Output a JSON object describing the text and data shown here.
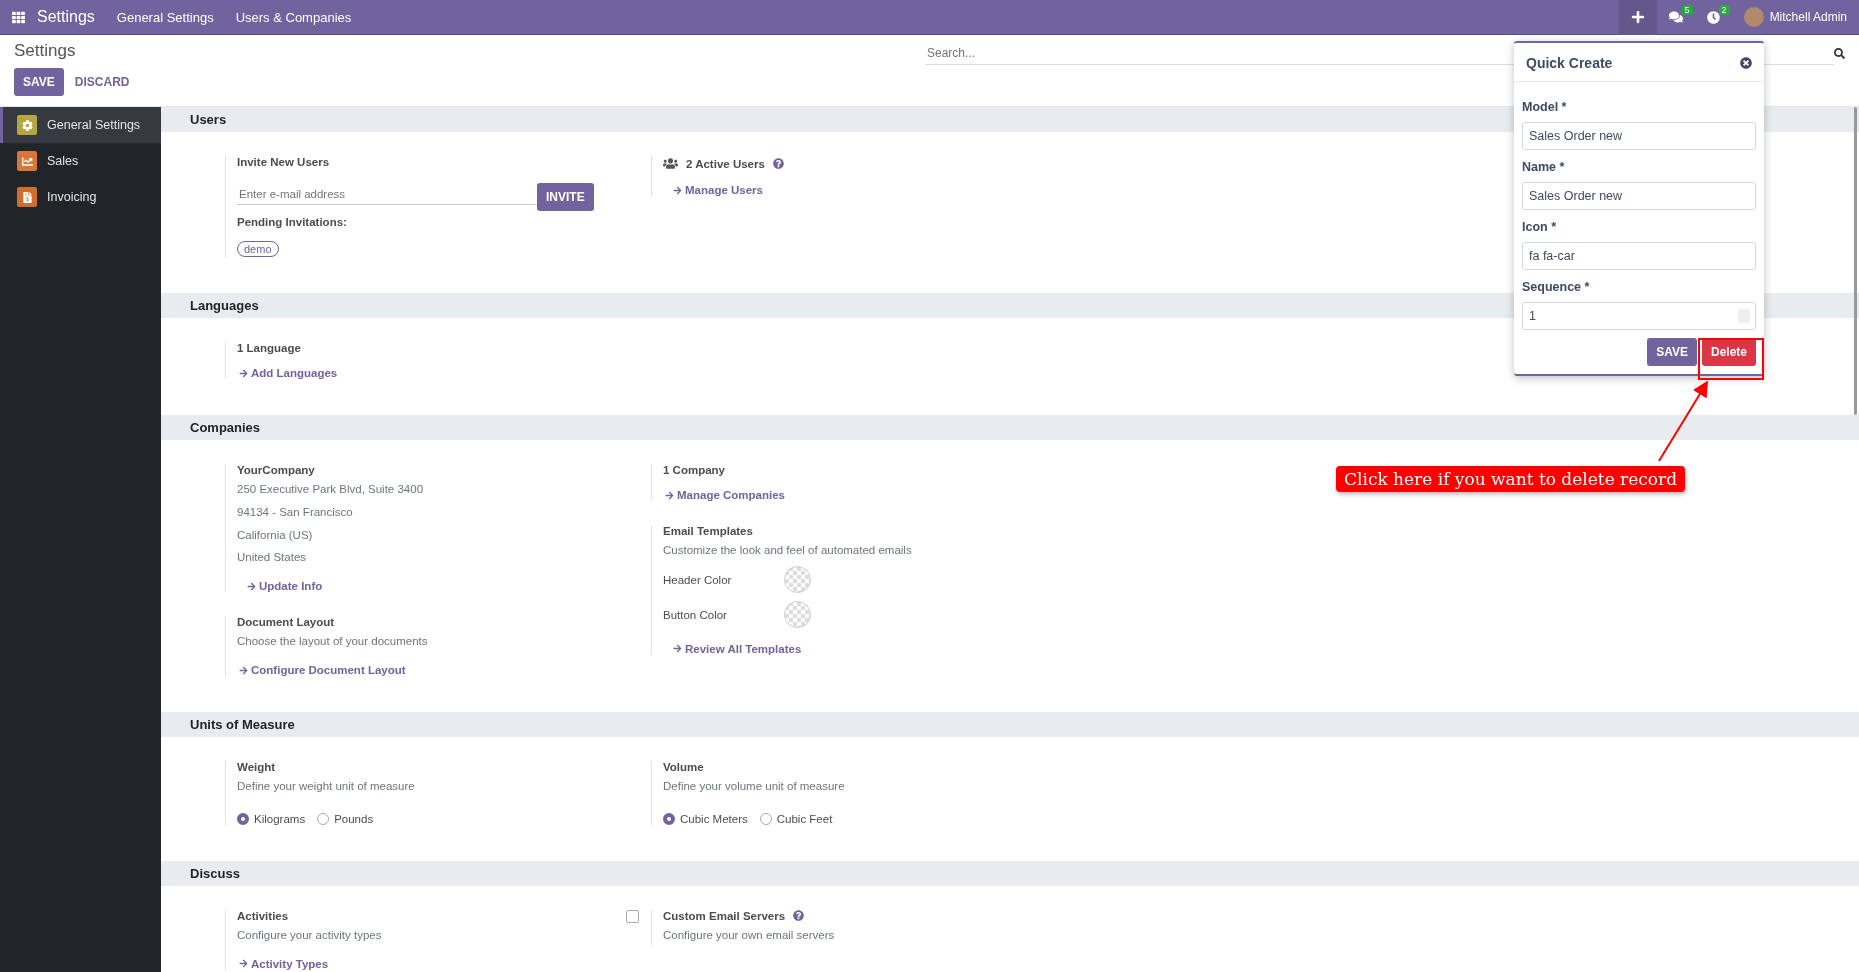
{
  "topbar": {
    "app_title": "Settings",
    "menu": [
      "General Settings",
      "Users & Companies"
    ],
    "messages_badge": "5",
    "activities_badge": "2",
    "user": "Mitchell Admin"
  },
  "control_panel": {
    "title": "Settings",
    "save": "SAVE",
    "discard": "DISCARD",
    "search_placeholder": "Search..."
  },
  "sidebar": {
    "items": [
      {
        "label": "General Settings",
        "selected": true
      },
      {
        "label": "Sales",
        "selected": false
      },
      {
        "label": "Invoicing",
        "selected": false
      }
    ]
  },
  "sections": [
    {
      "title": "Users",
      "columns": [
        [
          {
            "kind": "invite",
            "title": "Invite New Users",
            "placeholder": "Enter e-mail address",
            "button": "INVITE",
            "pending_label": "Pending Invitations:",
            "tags": [
              "demo"
            ]
          }
        ],
        [
          {
            "kind": "users",
            "title": "2 Active Users",
            "help": true,
            "links": [
              "Manage Users"
            ]
          }
        ]
      ]
    },
    {
      "title": "Languages",
      "columns": [
        [
          {
            "kind": "setting",
            "title": "1 Language",
            "links": [
              "Add Languages"
            ]
          }
        ],
        []
      ]
    },
    {
      "title": "Companies",
      "columns": [
        [
          {
            "kind": "address",
            "title": "YourCompany",
            "lines": [
              "250 Executive Park Blvd, Suite 3400",
              "94134 - San Francisco",
              "California (US)",
              "United States"
            ],
            "links": [
              "Update Info"
            ]
          },
          {
            "kind": "setting",
            "title": "Document Layout",
            "lines": [
              "Choose the layout of your documents"
            ],
            "links": [
              "Configure Document Layout"
            ]
          }
        ],
        [
          {
            "kind": "setting",
            "title": "1 Company",
            "links": [
              "Manage Companies"
            ]
          },
          {
            "kind": "setting",
            "title": "Email Templates",
            "lines": [
              "Customize the look and feel of automated emails"
            ],
            "colors": [
              "Header Color",
              "Button Color"
            ],
            "links": [
              "Review All Templates"
            ]
          }
        ]
      ]
    },
    {
      "title": "Units of Measure",
      "columns": [
        [
          {
            "kind": "setting",
            "title": "Weight",
            "lines": [
              "Define your weight unit of measure"
            ],
            "radios": [
              {
                "label": "Kilograms",
                "selected": true
              },
              {
                "label": "Pounds",
                "selected": false
              }
            ]
          }
        ],
        [
          {
            "kind": "setting",
            "title": "Volume",
            "lines": [
              "Define your volume unit of measure"
            ],
            "radios": [
              {
                "label": "Cubic Meters",
                "selected": true
              },
              {
                "label": "Cubic Feet",
                "selected": false
              }
            ]
          }
        ]
      ]
    },
    {
      "title": "Discuss",
      "columns": [
        [
          {
            "kind": "setting",
            "title": "Activities",
            "lines": [
              "Configure your activity types"
            ],
            "links": [
              "Activity Types"
            ],
            "checkbox": {
              "checked": false
            }
          }
        ],
        [
          {
            "kind": "setting",
            "title": "Custom Email Servers",
            "help": true,
            "lines": [
              "Configure your own email servers"
            ]
          }
        ]
      ]
    }
  ],
  "quick_create": {
    "title": "Quick Create",
    "fields": [
      {
        "kind": "text",
        "label": "Model *",
        "value": "Sales Order new"
      },
      {
        "kind": "text",
        "label": "Name *",
        "value": "Sales Order new"
      },
      {
        "kind": "text",
        "label": "Icon *",
        "value": "fa fa-car"
      },
      {
        "kind": "number",
        "label": "Sequence *",
        "value": "1"
      }
    ],
    "save": "SAVE",
    "delete": "Delete"
  },
  "annotation": {
    "text": "Click here if you want to delete record"
  }
}
